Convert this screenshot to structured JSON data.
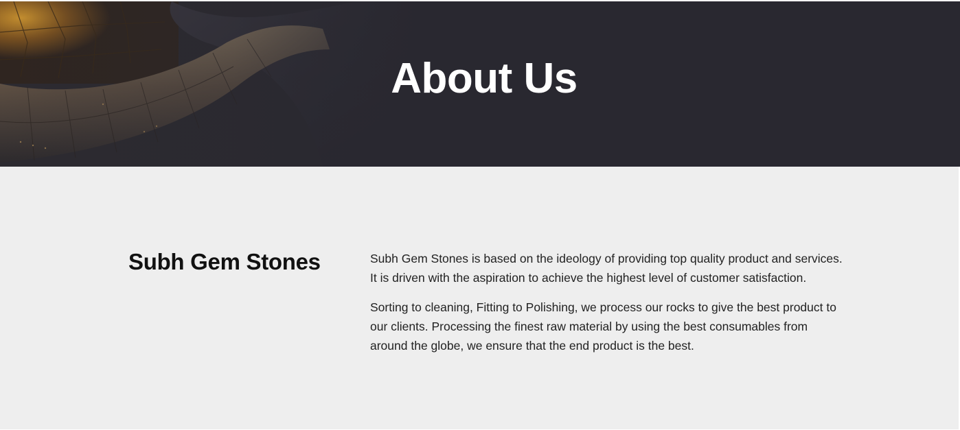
{
  "hero": {
    "title": "About Us",
    "background_color": "#292830",
    "image": "metallic-gold-curved-panels"
  },
  "about": {
    "heading": "Subh Gem Stones",
    "paragraphs": [
      "Subh Gem Stones is based on the ideology of providing top quality product and services. It is driven with the aspiration to achieve the highest level of customer satisfaction.",
      "Sorting to cleaning, Fitting to Polishing, we process our rocks to give the best product to our clients. Processing the finest raw material by using the best consumables from around the globe, we ensure that the end product is the best."
    ],
    "background_color": "#eeeeee"
  }
}
